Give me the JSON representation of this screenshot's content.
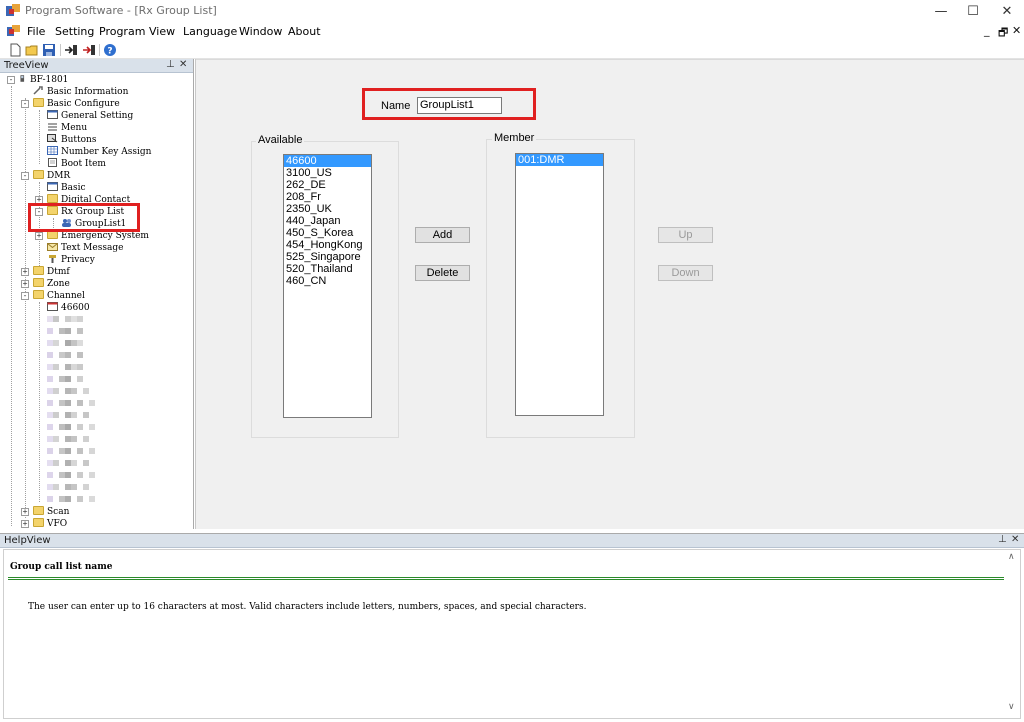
{
  "window": {
    "title": "Program Software - [Rx Group List]",
    "minimize_glyph": "—",
    "maximize_glyph": "☐",
    "close_glyph": "✕"
  },
  "menu": {
    "items": [
      "File",
      "Setting",
      "Program",
      "View",
      "Language",
      "Window",
      "About"
    ],
    "mdi_minimize": "_",
    "mdi_restore": "🗗",
    "mdi_close": "✕"
  },
  "toolbar": {
    "icons": [
      "new-file-icon",
      "open-folder-icon",
      "save-icon",
      "read-from-radio-icon",
      "write-to-radio-icon",
      "help-icon"
    ]
  },
  "treeview": {
    "title": "TreeView",
    "pin_glyph": "📌",
    "close_glyph": "✕",
    "nodes": {
      "root": "BF-1801",
      "basic_information": "Basic Information",
      "basic_configure": "Basic Configure",
      "general_setting": "General Setting",
      "menu": "Menu",
      "buttons": "Buttons",
      "number_key_assign": "Number Key Assign",
      "boot_item": "Boot Item",
      "dmr": "DMR",
      "basic": "Basic",
      "digital_contact": "Digital Contact",
      "rx_group_list": "Rx Group List",
      "grouplist1": "GroupList1",
      "emergency_system": "Emergency System",
      "text_message": "Text Message",
      "privacy": "Privacy",
      "dtmf": "Dtmf",
      "zone": "Zone",
      "channel": "Channel",
      "channel_46600": "46600",
      "scan": "Scan",
      "vfo": "VFO"
    }
  },
  "form": {
    "name_label": "Name",
    "name_value": "GroupList1",
    "available_label": "Available",
    "member_label": "Member",
    "available_items": [
      "46600",
      "3100_US",
      "262_DE",
      "208_Fr",
      "2350_UK",
      "440_Japan",
      "450_S_Korea",
      "454_HongKong",
      "525_Singapore",
      "520_Thailand",
      "460_CN"
    ],
    "available_selected_index": 0,
    "member_items": [
      "001:DMR"
    ],
    "member_selected_index": 0,
    "add_label": "Add",
    "delete_label": "Delete",
    "up_label": "Up",
    "down_label": "Down"
  },
  "helpview": {
    "title": "HelpView",
    "pin_glyph": "📌",
    "close_glyph": "✕",
    "heading": "Group call list name",
    "text": "The user can enter up to 16 characters at most. Valid characters include letters, numbers, spaces, and special characters."
  },
  "colors": {
    "highlight_red": "#e02020",
    "selection_blue": "#3399ff",
    "help_rule_green": "#2a8a2a",
    "pane_header": "#d9e1ea"
  }
}
